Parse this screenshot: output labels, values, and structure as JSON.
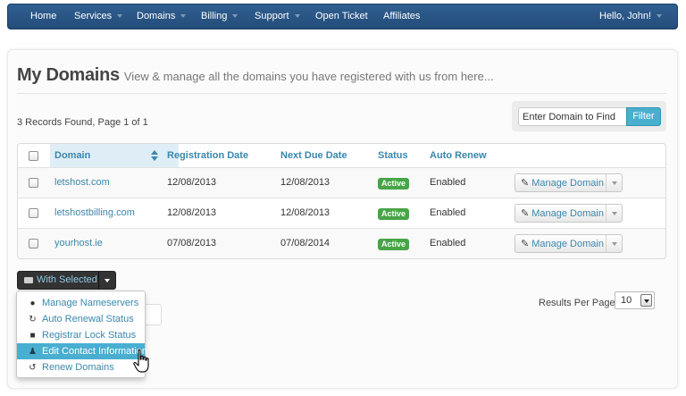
{
  "navbar": {
    "items": [
      {
        "label": "Home",
        "has_caret": false
      },
      {
        "label": "Services",
        "has_caret": true
      },
      {
        "label": "Domains",
        "has_caret": true
      },
      {
        "label": "Billing",
        "has_caret": true
      },
      {
        "label": "Support",
        "has_caret": true
      },
      {
        "label": "Open Ticket",
        "has_caret": false
      },
      {
        "label": "Affiliates",
        "has_caret": false
      }
    ],
    "user": "Hello, John!"
  },
  "page": {
    "title": "My Domains",
    "subtitle": "View & manage all the domains you have registered with us from here...",
    "records_found": "3 Records Found, Page 1 of 1"
  },
  "filter": {
    "placeholder": "Enter Domain to Find",
    "button": "Filter"
  },
  "table": {
    "headers": {
      "domain": "Domain",
      "registration_date": "Registration Date",
      "next_due_date": "Next Due Date",
      "status": "Status",
      "auto_renew": "Auto Renew"
    },
    "rows": [
      {
        "domain": "letshost.com",
        "registration_date": "12/08/2013",
        "next_due_date": "12/08/2013",
        "status": "Active",
        "auto_renew": "Enabled",
        "action": "Manage Domain"
      },
      {
        "domain": "letshostbilling.com",
        "registration_date": "12/08/2013",
        "next_due_date": "12/08/2013",
        "status": "Active",
        "auto_renew": "Enabled",
        "action": "Manage Domain"
      },
      {
        "domain": "yourhost.ie",
        "registration_date": "07/08/2013",
        "next_due_date": "07/08/2014",
        "status": "Active",
        "auto_renew": "Enabled",
        "action": "Manage Domain"
      }
    ]
  },
  "bulk": {
    "button": "With Selected",
    "menu": [
      {
        "label": "Manage Nameservers",
        "icon": "globe-icon",
        "glyph": "●"
      },
      {
        "label": "Auto Renewal Status",
        "icon": "refresh-icon",
        "glyph": "↻"
      },
      {
        "label": "Registrar Lock Status",
        "icon": "lock-icon",
        "glyph": "■"
      },
      {
        "label": "Edit Contact Information",
        "icon": "user-icon",
        "glyph": "♟",
        "active": true
      },
      {
        "label": "Renew Domains",
        "icon": "renew-icon",
        "glyph": "↺"
      }
    ]
  },
  "results_per_page": {
    "label": "Results Per Page:",
    "value": "10"
  },
  "colors": {
    "navbar": "#2f5f91",
    "link": "#3a87ad",
    "active_badge": "#47a447",
    "filter_button": "#49afcd",
    "menu_highlight": "#49aed0"
  }
}
